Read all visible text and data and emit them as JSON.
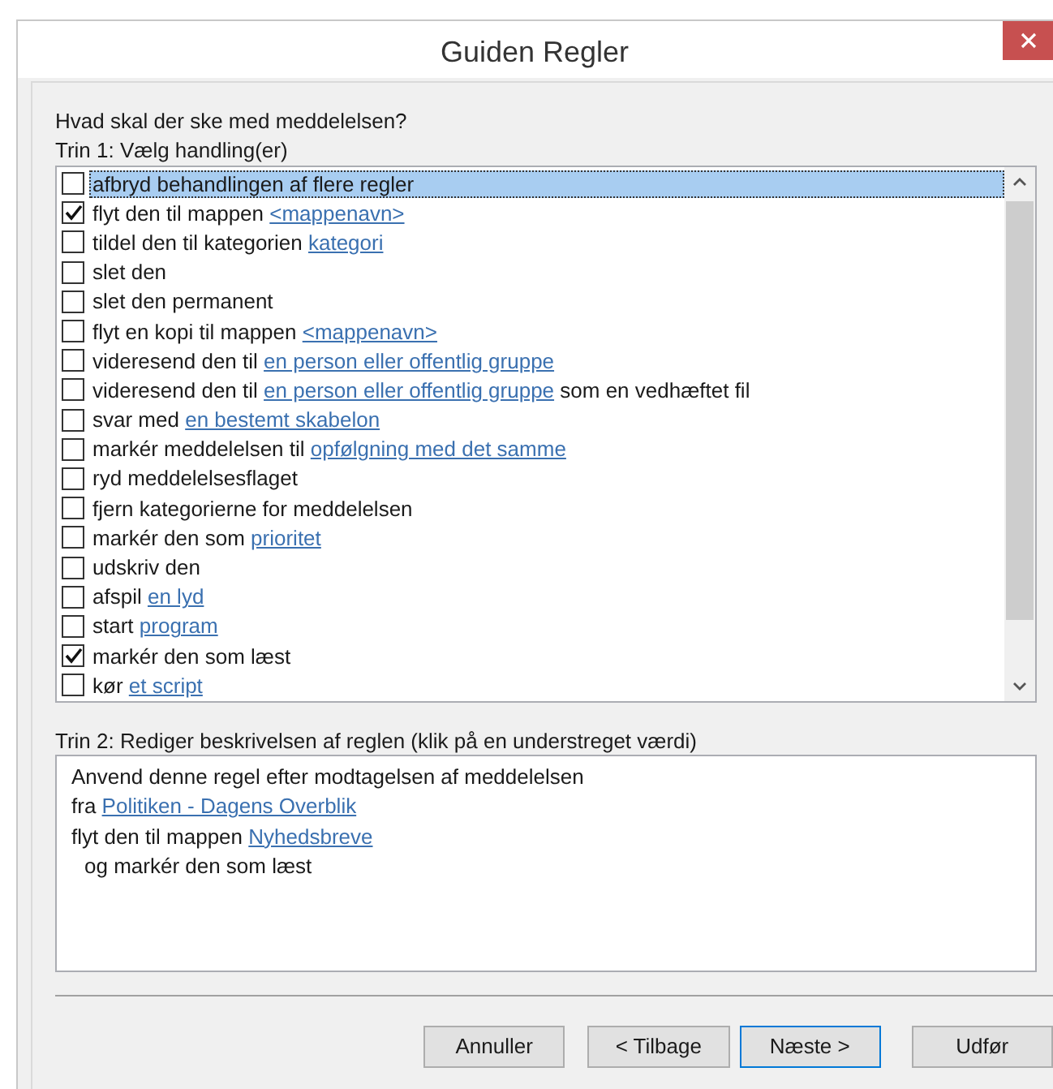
{
  "window": {
    "title": "Guiden Regler"
  },
  "question": "Hvad skal der ske med meddelelsen?",
  "step1": {
    "label": "Trin 1: Vælg handling(er)",
    "actions": [
      {
        "checked": false,
        "selected": true,
        "parts": [
          {
            "kind": "text",
            "text": "afbryd behandlingen af flere regler"
          }
        ]
      },
      {
        "checked": true,
        "selected": false,
        "parts": [
          {
            "kind": "text",
            "text": "flyt den til mappen"
          },
          {
            "kind": "link",
            "text": "<mappenavn>"
          }
        ]
      },
      {
        "checked": false,
        "selected": false,
        "parts": [
          {
            "kind": "text",
            "text": "tildel den til kategorien"
          },
          {
            "kind": "link",
            "text": "kategori"
          }
        ]
      },
      {
        "checked": false,
        "selected": false,
        "parts": [
          {
            "kind": "text",
            "text": "slet den"
          }
        ]
      },
      {
        "checked": false,
        "selected": false,
        "parts": [
          {
            "kind": "text",
            "text": "slet den permanent"
          }
        ]
      },
      {
        "checked": false,
        "selected": false,
        "parts": [
          {
            "kind": "text",
            "text": "flyt en kopi til mappen"
          },
          {
            "kind": "link",
            "text": "<mappenavn>"
          }
        ]
      },
      {
        "checked": false,
        "selected": false,
        "parts": [
          {
            "kind": "text",
            "text": "videresend den til"
          },
          {
            "kind": "link",
            "text": "en person eller offentlig gruppe"
          }
        ]
      },
      {
        "checked": false,
        "selected": false,
        "parts": [
          {
            "kind": "text",
            "text": "videresend den til"
          },
          {
            "kind": "link",
            "text": "en person eller offentlig gruppe"
          },
          {
            "kind": "text",
            "text": "som en vedhæftet fil"
          }
        ]
      },
      {
        "checked": false,
        "selected": false,
        "parts": [
          {
            "kind": "text",
            "text": "svar med"
          },
          {
            "kind": "link",
            "text": "en bestemt skabelon"
          }
        ]
      },
      {
        "checked": false,
        "selected": false,
        "parts": [
          {
            "kind": "text",
            "text": "markér meddelelsen til"
          },
          {
            "kind": "link",
            "text": "opfølgning med det samme"
          }
        ]
      },
      {
        "checked": false,
        "selected": false,
        "parts": [
          {
            "kind": "text",
            "text": "ryd meddelelsesflaget"
          }
        ]
      },
      {
        "checked": false,
        "selected": false,
        "parts": [
          {
            "kind": "text",
            "text": "fjern kategorierne for meddelelsen"
          }
        ]
      },
      {
        "checked": false,
        "selected": false,
        "parts": [
          {
            "kind": "text",
            "text": "markér den som"
          },
          {
            "kind": "link",
            "text": "prioritet"
          }
        ]
      },
      {
        "checked": false,
        "selected": false,
        "parts": [
          {
            "kind": "text",
            "text": "udskriv den"
          }
        ]
      },
      {
        "checked": false,
        "selected": false,
        "parts": [
          {
            "kind": "text",
            "text": "afspil"
          },
          {
            "kind": "link",
            "text": "en lyd"
          }
        ]
      },
      {
        "checked": false,
        "selected": false,
        "parts": [
          {
            "kind": "text",
            "text": "start"
          },
          {
            "kind": "link",
            "text": "program"
          }
        ]
      },
      {
        "checked": true,
        "selected": false,
        "parts": [
          {
            "kind": "text",
            "text": "markér den som læst"
          }
        ]
      },
      {
        "checked": false,
        "selected": false,
        "parts": [
          {
            "kind": "text",
            "text": "kør"
          },
          {
            "kind": "link",
            "text": "et script"
          }
        ]
      }
    ]
  },
  "step2": {
    "label": "Trin 2: Rediger beskrivelsen af reglen (klik på en understreget værdi)",
    "lines": [
      {
        "indented": false,
        "parts": [
          {
            "kind": "text",
            "text": "Anvend denne regel efter modtagelsen af meddelelsen"
          }
        ]
      },
      {
        "indented": false,
        "parts": [
          {
            "kind": "text",
            "text": "fra"
          },
          {
            "kind": "link",
            "text": "Politiken - Dagens Overblik"
          }
        ]
      },
      {
        "indented": false,
        "parts": [
          {
            "kind": "text",
            "text": "flyt den til mappen"
          },
          {
            "kind": "link",
            "text": "Nyhedsbreve"
          }
        ]
      },
      {
        "indented": true,
        "parts": [
          {
            "kind": "text",
            "text": "og markér den som læst"
          }
        ]
      }
    ]
  },
  "buttons": [
    {
      "label": "Annuller",
      "default": false
    },
    {
      "label": "< Tilbage",
      "default": false
    },
    {
      "label": "Næste >",
      "default": true
    },
    {
      "label": "Udfør",
      "default": false
    }
  ]
}
